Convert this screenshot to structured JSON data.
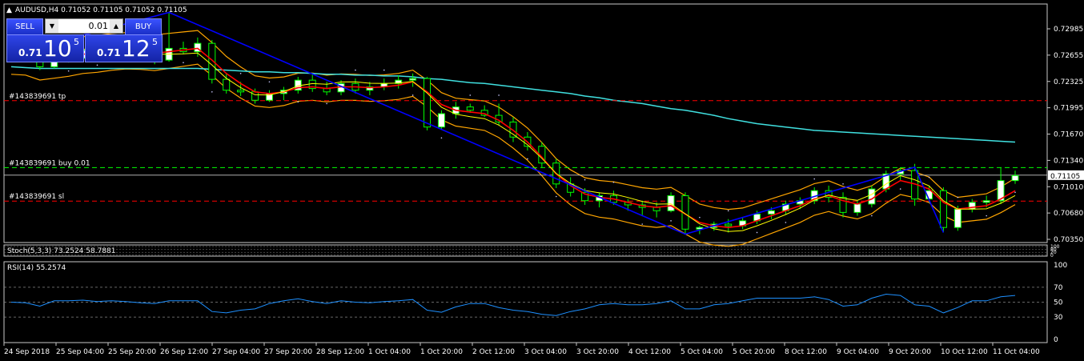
{
  "window": {
    "header": "AUDUSD,H4  0.71052 0.71105 0.71052 0.71105",
    "collapse_icon": "triangle-up-icon"
  },
  "trade_panel": {
    "sell_label": "SELL",
    "buy_label": "BUY",
    "lot": "0.01",
    "sell_prefix": "0.71",
    "sell_big": "10",
    "sell_sup": "5",
    "buy_prefix": "0.71",
    "buy_big": "12",
    "buy_sup": "5"
  },
  "price_axis": [
    "0.72985",
    "0.72655",
    "0.72325",
    "0.71995",
    "0.71670",
    "0.71340",
    "0.71010",
    "0.70680",
    "0.70350"
  ],
  "current_price": "0.71105",
  "order_lines": [
    {
      "label": "#143839691 tp",
      "price": 0.71995,
      "color": "#ff0000"
    },
    {
      "label": "#143839691 buy 0.01",
      "price": 0.71195,
      "color": "#00ff00"
    },
    {
      "label": "#143839691 sl",
      "price": 0.70795,
      "color": "#ff0000"
    }
  ],
  "stoch": {
    "label": "Stoch(5,3,3) 73.2524 58.7881",
    "levels": [
      "100",
      "80",
      "20",
      "0"
    ]
  },
  "rsi": {
    "label": "RSI(14) 55.2574",
    "levels": [
      "100",
      "70",
      "50",
      "30",
      "0"
    ]
  },
  "time_axis": [
    "24 Sep 2018",
    "25 Sep 04:00",
    "25 Sep 20:00",
    "26 Sep 12:00",
    "27 Sep 04:00",
    "27 Sep 20:00",
    "28 Sep 12:00",
    "1 Oct 04:00",
    "1 Oct 20:00",
    "2 Oct 12:00",
    "3 Oct 04:00",
    "3 Oct 20:00",
    "4 Oct 12:00",
    "5 Oct 04:00",
    "5 Oct 20:00",
    "8 Oct 12:00",
    "9 Oct 04:00",
    "9 Oct 20:00",
    "10 Oct 12:00",
    "11 Oct 04:00"
  ],
  "colors": {
    "bull": "#ffffff",
    "bear": "#000000",
    "wick": "#00ff00",
    "ma_red": "#ff0000",
    "ma_yellow": "#ffff00",
    "bands": "#ffa500",
    "ma_cyan": "#40e0e0",
    "zigzag": "#0000ff",
    "rsi": "#1e90ff"
  },
  "chart_data": {
    "type": "candlestick",
    "symbol": "AUDUSD",
    "timeframe": "H4",
    "ylim": [
      0.703,
      0.7315
    ],
    "candles": [
      [
        0.7252,
        0.7262,
        0.7247,
        0.7258
      ],
      [
        0.7258,
        0.7268,
        0.725,
        0.7255
      ],
      [
        0.7255,
        0.726,
        0.7236,
        0.724
      ],
      [
        0.724,
        0.7255,
        0.7238,
        0.7252
      ],
      [
        0.7252,
        0.7262,
        0.7245,
        0.725
      ],
      [
        0.725,
        0.7262,
        0.7248,
        0.726
      ],
      [
        0.726,
        0.7265,
        0.7252,
        0.7256
      ],
      [
        0.7256,
        0.7262,
        0.725,
        0.7258
      ],
      [
        0.7258,
        0.7268,
        0.7254,
        0.7262
      ],
      [
        0.7262,
        0.7268,
        0.7255,
        0.726
      ],
      [
        0.726,
        0.7266,
        0.7243,
        0.7248
      ],
      [
        0.7248,
        0.7305,
        0.7246,
        0.7262
      ],
      [
        0.7262,
        0.727,
        0.7255,
        0.7258
      ],
      [
        0.7258,
        0.7275,
        0.7252,
        0.7268
      ],
      [
        0.7268,
        0.7272,
        0.722,
        0.7225
      ],
      [
        0.7225,
        0.7232,
        0.7208,
        0.7212
      ],
      [
        0.7212,
        0.7222,
        0.7205,
        0.721
      ],
      [
        0.721,
        0.7214,
        0.7196,
        0.72
      ],
      [
        0.72,
        0.7212,
        0.7198,
        0.7208
      ],
      [
        0.7208,
        0.7216,
        0.72,
        0.7212
      ],
      [
        0.7212,
        0.7228,
        0.7208,
        0.7224
      ],
      [
        0.7224,
        0.7232,
        0.721,
        0.7214
      ],
      [
        0.7214,
        0.7222,
        0.7206,
        0.721
      ],
      [
        0.721,
        0.7224,
        0.7206,
        0.722
      ],
      [
        0.722,
        0.7226,
        0.7208,
        0.7212
      ],
      [
        0.7212,
        0.7222,
        0.7206,
        0.7216
      ],
      [
        0.7216,
        0.7226,
        0.7212,
        0.722
      ],
      [
        0.722,
        0.723,
        0.7214,
        0.7224
      ],
      [
        0.7224,
        0.7232,
        0.7216,
        0.7226
      ],
      [
        0.7226,
        0.7228,
        0.7164,
        0.7168
      ],
      [
        0.7168,
        0.7188,
        0.7165,
        0.7184
      ],
      [
        0.7184,
        0.7198,
        0.7178,
        0.7192
      ],
      [
        0.7192,
        0.7196,
        0.7185,
        0.7188
      ],
      [
        0.7188,
        0.7194,
        0.718,
        0.7182
      ],
      [
        0.7182,
        0.7196,
        0.717,
        0.7174
      ],
      [
        0.7174,
        0.718,
        0.715,
        0.7156
      ],
      [
        0.7156,
        0.7162,
        0.714,
        0.7145
      ],
      [
        0.7145,
        0.715,
        0.712,
        0.7125
      ],
      [
        0.7125,
        0.713,
        0.7095,
        0.71
      ],
      [
        0.71,
        0.7108,
        0.7085,
        0.709
      ],
      [
        0.709,
        0.7095,
        0.7075,
        0.708
      ],
      [
        0.708,
        0.709,
        0.7072,
        0.7086
      ],
      [
        0.7086,
        0.7092,
        0.7075,
        0.7078
      ],
      [
        0.7078,
        0.7082,
        0.7068,
        0.7075
      ],
      [
        0.7075,
        0.708,
        0.7062,
        0.7072
      ],
      [
        0.7072,
        0.7078,
        0.706,
        0.7068
      ],
      [
        0.7068,
        0.709,
        0.7066,
        0.7086
      ],
      [
        0.7086,
        0.709,
        0.704,
        0.7046
      ],
      [
        0.7046,
        0.705,
        0.704,
        0.7048
      ],
      [
        0.7048,
        0.7055,
        0.7044,
        0.7052
      ],
      [
        0.7052,
        0.7058,
        0.7042,
        0.705
      ],
      [
        0.705,
        0.706,
        0.7046,
        0.7056
      ],
      [
        0.7056,
        0.7068,
        0.7052,
        0.7064
      ],
      [
        0.7064,
        0.7072,
        0.7058,
        0.7068
      ],
      [
        0.7068,
        0.708,
        0.7064,
        0.7076
      ],
      [
        0.7076,
        0.7084,
        0.707,
        0.708
      ],
      [
        0.708,
        0.7096,
        0.7076,
        0.7092
      ],
      [
        0.7092,
        0.7098,
        0.7078,
        0.7084
      ],
      [
        0.7084,
        0.709,
        0.706,
        0.7066
      ],
      [
        0.7066,
        0.708,
        0.7062,
        0.7076
      ],
      [
        0.7076,
        0.7098,
        0.7072,
        0.7094
      ],
      [
        0.7094,
        0.7116,
        0.709,
        0.7112
      ],
      [
        0.7112,
        0.712,
        0.7104,
        0.7116
      ],
      [
        0.7116,
        0.7124,
        0.7074,
        0.7082
      ],
      [
        0.7082,
        0.7098,
        0.7078,
        0.7092
      ],
      [
        0.7092,
        0.7096,
        0.7042,
        0.7048
      ],
      [
        0.7048,
        0.7074,
        0.7044,
        0.707
      ],
      [
        0.707,
        0.7082,
        0.7066,
        0.7078
      ],
      [
        0.7078,
        0.7086,
        0.7072,
        0.708
      ],
      [
        0.708,
        0.712,
        0.7076,
        0.7104
      ],
      [
        0.7104,
        0.7116,
        0.71,
        0.711
      ]
    ],
    "ma_red": [
      0.7255,
      0.7254,
      0.7248,
      0.725,
      0.7252,
      0.7255,
      0.7256,
      0.7258,
      0.7259,
      0.7258,
      0.7256,
      0.7258,
      0.726,
      0.7262,
      0.7248,
      0.7232,
      0.722,
      0.721,
      0.7208,
      0.721,
      0.7215,
      0.7216,
      0.7214,
      0.7216,
      0.7216,
      0.7215,
      0.7216,
      0.7218,
      0.7222,
      0.721,
      0.7195,
      0.7188,
      0.7186,
      0.7184,
      0.7176,
      0.7164,
      0.715,
      0.7132,
      0.7112,
      0.7098,
      0.7088,
      0.7084,
      0.7082,
      0.7078,
      0.7074,
      0.7072,
      0.7074,
      0.7064,
      0.7054,
      0.705,
      0.7048,
      0.705,
      0.7056,
      0.7062,
      0.7068,
      0.7074,
      0.7082,
      0.7086,
      0.708,
      0.7076,
      0.7082,
      0.7094,
      0.7104,
      0.71,
      0.7094,
      0.7078,
      0.707,
      0.7072,
      0.7074,
      0.7082,
      0.7092
    ],
    "ma_cyan": [
      0.724,
      0.7239,
      0.7238,
      0.7238,
      0.7238,
      0.7238,
      0.7238,
      0.7238,
      0.7238,
      0.7238,
      0.7238,
      0.7238,
      0.7238,
      0.7238,
      0.7237,
      0.7236,
      0.7235,
      0.7234,
      0.7234,
      0.7233,
      0.7233,
      0.7232,
      0.7231,
      0.7231,
      0.723,
      0.723,
      0.7229,
      0.7229,
      0.7228,
      0.7226,
      0.7225,
      0.7223,
      0.7221,
      0.722,
      0.7218,
      0.7216,
      0.7214,
      0.7212,
      0.721,
      0.7208,
      0.7205,
      0.7203,
      0.72,
      0.7198,
      0.7196,
      0.7193,
      0.719,
      0.7188,
      0.7185,
      0.7182,
      0.7178,
      0.7175,
      0.7172,
      0.717,
      0.7168,
      0.7166,
      0.7164,
      0.7163,
      0.7162,
      0.7161,
      0.716,
      0.7159,
      0.7158,
      0.7157,
      0.7156,
      0.7155,
      0.7154,
      0.7153,
      0.7152,
      0.7151,
      0.715
    ]
  }
}
